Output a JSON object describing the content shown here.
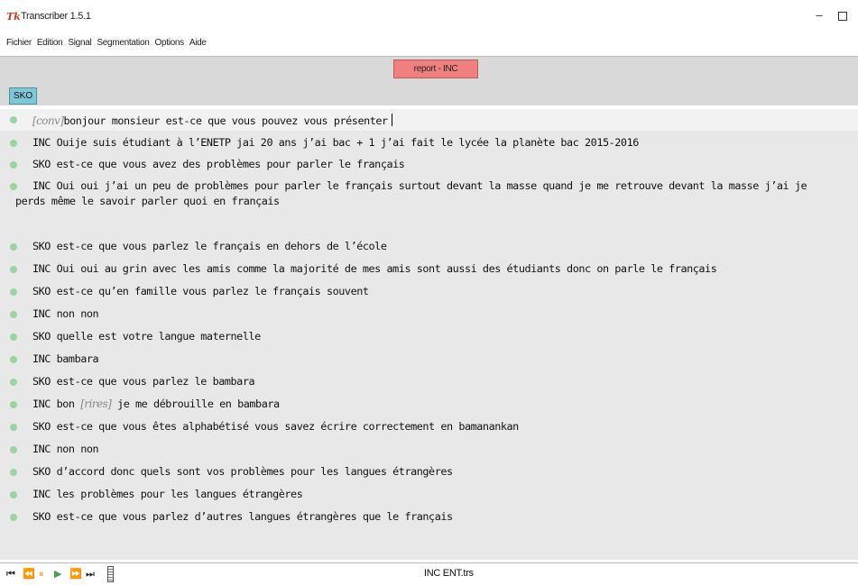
{
  "window": {
    "title": "Transcriber 1.5.1",
    "app_icon": "Tk",
    "minimize_label": "–"
  },
  "menu": [
    "Fichier",
    "Edition",
    "Signal",
    "Segmentation",
    "Options",
    "Aide"
  ],
  "turn_button": "report - INC",
  "speaker": "SKO",
  "transcript": [
    {
      "tag": "[conv]",
      "text": "bonjour monsieur est-ce que vous pouvez vous présenter"
    },
    {
      "text": "INC Ouije suis étudiant à l’ENETP jai 20 ans j’ai bac + 1 j’ai fait le lycée la planète bac 2015-2016"
    },
    {
      "text": "SKO est-ce que vous avez des problèmes pour parler le français"
    },
    {
      "text": "INC Oui oui j’ai un peu de problèmes pour parler le français surtout devant la masse quand je me retrouve devant la masse j’ai je",
      "text2": "perds même le savoir parler quoi en français"
    },
    {
      "text": "SKO est-ce que vous parlez le français en dehors de l’école"
    },
    {
      "text": "INC Oui oui au grin avec les amis comme la majorité de mes amis sont aussi des étudiants donc on parle le français"
    },
    {
      "text": "SKO est-ce qu’en famille vous parlez le français souvent"
    },
    {
      "text": "INC non non"
    },
    {
      "text": "SKO quelle est votre langue maternelle"
    },
    {
      "text": "INC bambara"
    },
    {
      "text": "SKO est-ce que vous parlez le bambara"
    },
    {
      "text": "INC bon",
      "tag": "[rires]",
      "text_after": "je me débrouille en bambara"
    },
    {
      "text": "SKO est-ce que vous êtes alphabétisé vous savez écrire correctement en bamanankan"
    },
    {
      "text": "INC non non"
    },
    {
      "text": "SKO d’accord donc quels sont vos problèmes pour les langues étrangères"
    },
    {
      "text": "INC les problèmes pour les langues étrangères"
    },
    {
      "text": "SKO est-ce que vous parlez d’autres langues étrangères que le français"
    }
  ],
  "controls": {
    "start": "⏮",
    "rewind": "⏪",
    "pause": "⏸",
    "play": "▶",
    "forward": "⏩",
    "end": "⏭",
    "pause_color": "#f0a830",
    "play_color": "#3fa34d"
  },
  "status": {
    "file": "INC ENT.trs"
  }
}
